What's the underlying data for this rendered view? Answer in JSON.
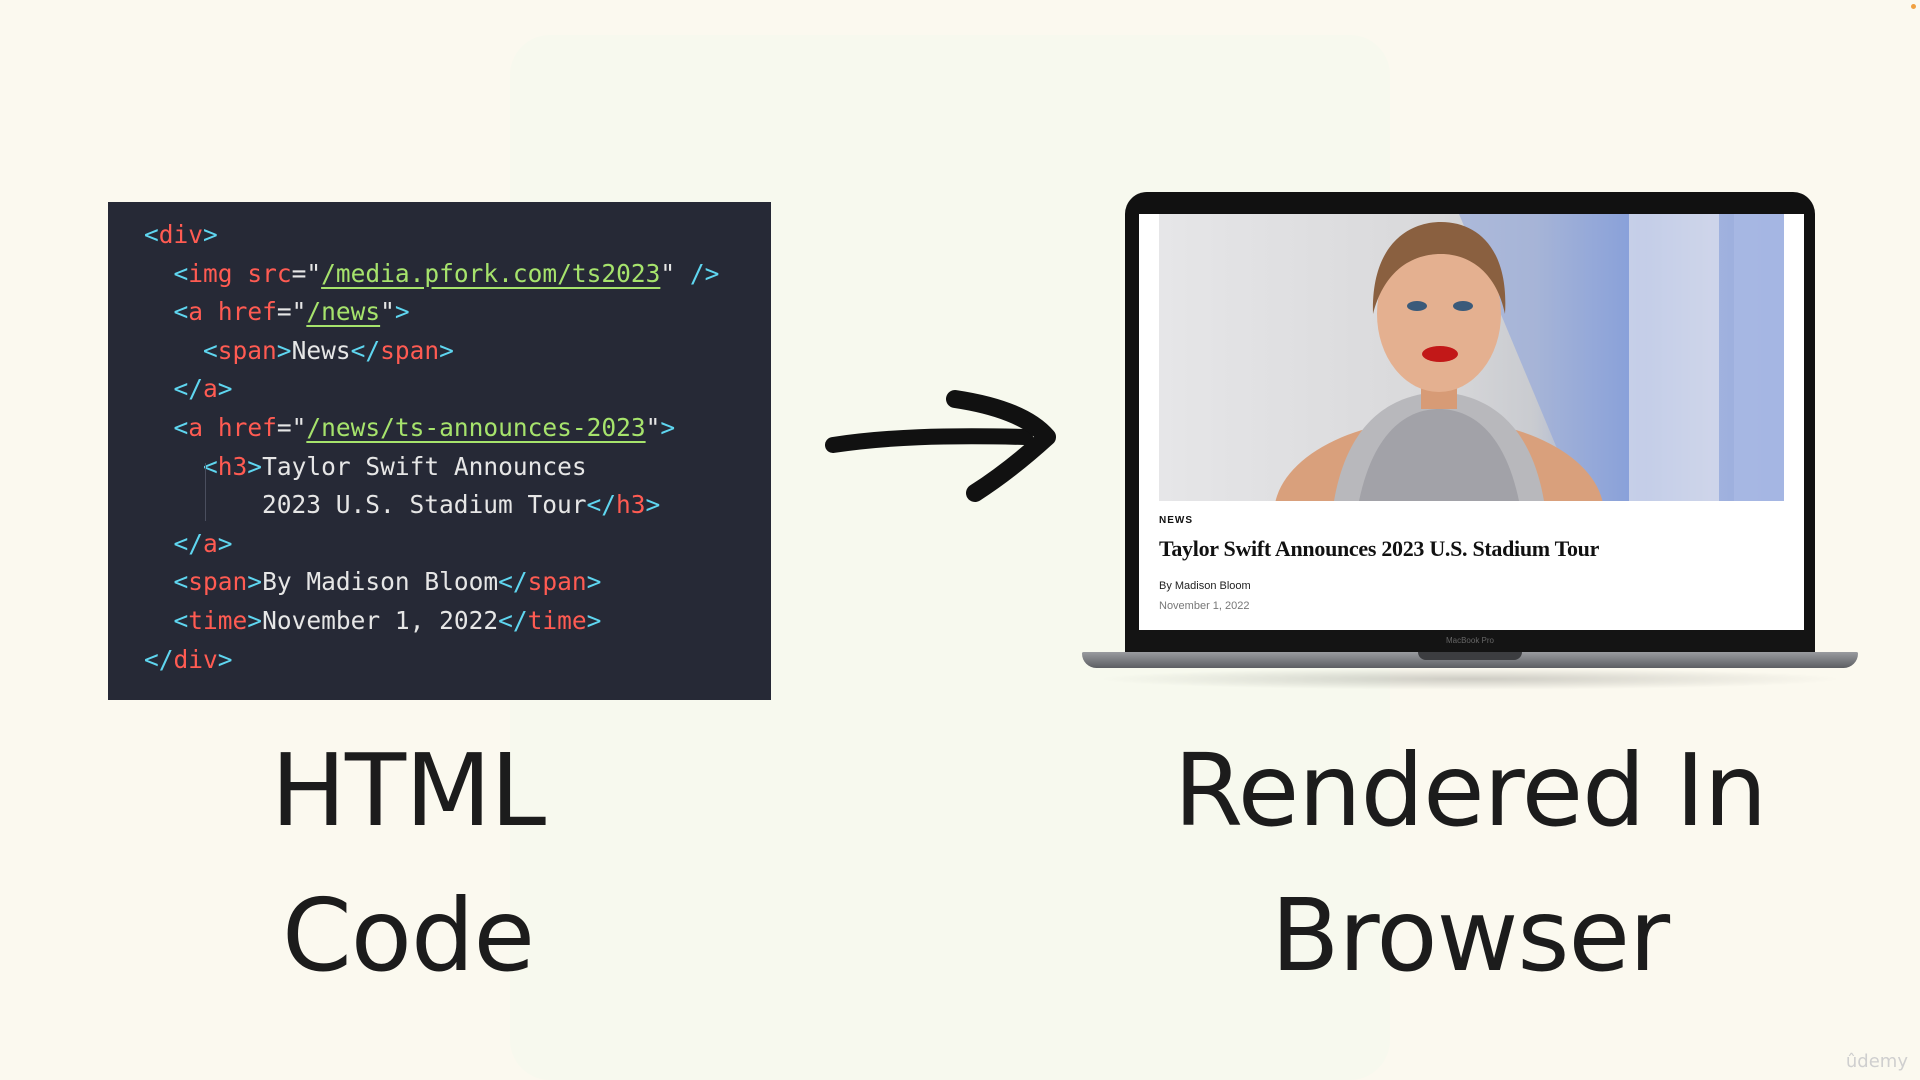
{
  "code": {
    "lines": [
      [
        {
          "c": "br",
          "t": "<"
        },
        {
          "c": "tag",
          "t": "div"
        },
        {
          "c": "br",
          "t": ">"
        }
      ],
      [
        {
          "c": "txt",
          "t": "  "
        },
        {
          "c": "br",
          "t": "<"
        },
        {
          "c": "tag",
          "t": "img"
        },
        {
          "c": "txt",
          "t": " "
        },
        {
          "c": "attr",
          "t": "src"
        },
        {
          "c": "q",
          "t": "=\""
        },
        {
          "c": "val",
          "t": "/media.pfork.com/ts2023"
        },
        {
          "c": "q",
          "t": "\" "
        },
        {
          "c": "br",
          "t": "/>"
        }
      ],
      [
        {
          "c": "txt",
          "t": "  "
        },
        {
          "c": "br",
          "t": "<"
        },
        {
          "c": "tag",
          "t": "a"
        },
        {
          "c": "txt",
          "t": " "
        },
        {
          "c": "attr",
          "t": "href"
        },
        {
          "c": "q",
          "t": "=\""
        },
        {
          "c": "val",
          "t": "/news"
        },
        {
          "c": "q",
          "t": "\""
        },
        {
          "c": "br",
          "t": ">"
        }
      ],
      [
        {
          "c": "txt",
          "t": "    "
        },
        {
          "c": "br",
          "t": "<"
        },
        {
          "c": "tag",
          "t": "span"
        },
        {
          "c": "br",
          "t": ">"
        },
        {
          "c": "txt",
          "t": "News"
        },
        {
          "c": "br",
          "t": "</"
        },
        {
          "c": "tag",
          "t": "span"
        },
        {
          "c": "br",
          "t": ">"
        }
      ],
      [
        {
          "c": "txt",
          "t": "  "
        },
        {
          "c": "br",
          "t": "</"
        },
        {
          "c": "tag",
          "t": "a"
        },
        {
          "c": "br",
          "t": ">"
        }
      ],
      [
        {
          "c": "txt",
          "t": "  "
        },
        {
          "c": "br",
          "t": "<"
        },
        {
          "c": "tag",
          "t": "a"
        },
        {
          "c": "txt",
          "t": " "
        },
        {
          "c": "attr",
          "t": "href"
        },
        {
          "c": "q",
          "t": "=\""
        },
        {
          "c": "val",
          "t": "/news/ts-announces-2023"
        },
        {
          "c": "q",
          "t": "\""
        },
        {
          "c": "br",
          "t": ">"
        }
      ],
      [
        {
          "c": "txt",
          "t": "    "
        },
        {
          "c": "br",
          "t": "<"
        },
        {
          "c": "tag",
          "t": "h3"
        },
        {
          "c": "br",
          "t": ">"
        },
        {
          "c": "txt",
          "t": "Taylor Swift Announces"
        }
      ],
      [
        {
          "c": "txt",
          "t": "        2023 U.S. Stadium Tour"
        },
        {
          "c": "br",
          "t": "</"
        },
        {
          "c": "tag",
          "t": "h3"
        },
        {
          "c": "br",
          "t": ">"
        }
      ],
      [
        {
          "c": "txt",
          "t": "  "
        },
        {
          "c": "br",
          "t": "</"
        },
        {
          "c": "tag",
          "t": "a"
        },
        {
          "c": "br",
          "t": ">"
        }
      ],
      [
        {
          "c": "txt",
          "t": "  "
        },
        {
          "c": "br",
          "t": "<"
        },
        {
          "c": "tag",
          "t": "span"
        },
        {
          "c": "br",
          "t": ">"
        },
        {
          "c": "txt",
          "t": "By Madison Bloom"
        },
        {
          "c": "br",
          "t": "</"
        },
        {
          "c": "tag",
          "t": "span"
        },
        {
          "c": "br",
          "t": ">"
        }
      ],
      [
        {
          "c": "txt",
          "t": "  "
        },
        {
          "c": "br",
          "t": "<"
        },
        {
          "c": "tag",
          "t": "time"
        },
        {
          "c": "br",
          "t": ">"
        },
        {
          "c": "txt",
          "t": "November 1, 2022"
        },
        {
          "c": "br",
          "t": "</"
        },
        {
          "c": "tag",
          "t": "time"
        },
        {
          "c": "br",
          "t": ">"
        }
      ],
      [
        {
          "c": "br",
          "t": "</"
        },
        {
          "c": "tag",
          "t": "div"
        },
        {
          "c": "br",
          "t": ">"
        }
      ]
    ]
  },
  "captions": {
    "left_line1": "HTML",
    "left_line2": "Code",
    "right_line1": "Rendered In",
    "right_line2": "Browser"
  },
  "article": {
    "label": "NEWS",
    "headline": "Taylor Swift Announces 2023 U.S. Stadium Tour",
    "byline": "By Madison Bloom",
    "date": "November 1, 2022"
  },
  "laptop": {
    "model": "MacBook Pro"
  },
  "watermark": "ûdemy",
  "colors": {
    "background": "#fbf9ef",
    "code_bg": "#262936",
    "tag": "#ff5b52",
    "bracket": "#5fd6f0",
    "value": "#a6e36c"
  },
  "icons": {
    "arrow": "arrow-right-icon"
  }
}
